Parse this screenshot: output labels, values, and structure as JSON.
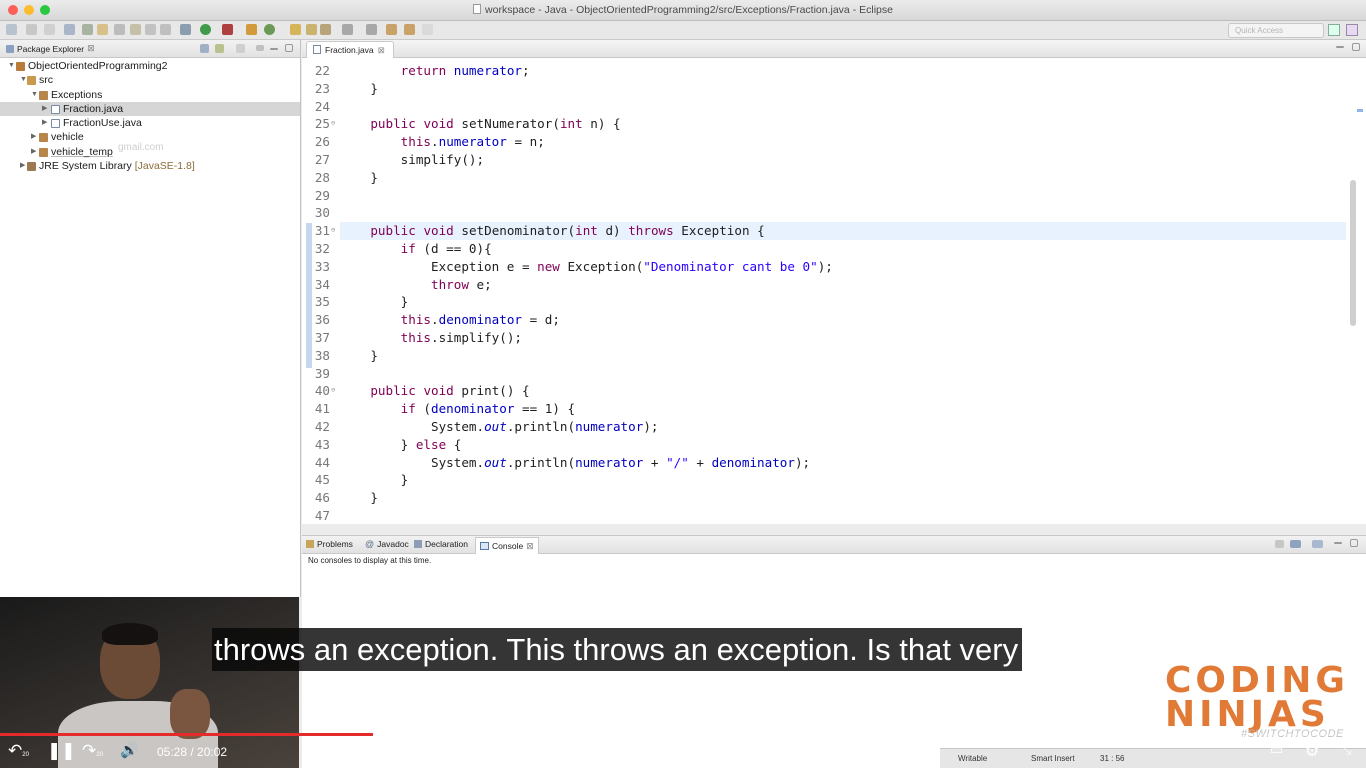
{
  "window": {
    "title": "workspace - Java - ObjectOrientedProgramming2/src/Exceptions/Fraction.java - Eclipse",
    "colors": {
      "close": "#fc5f57",
      "minimize": "#fdbc2e",
      "zoom": "#28c840"
    }
  },
  "toolbar": {
    "quick_access_placeholder": "Quick Access"
  },
  "package_explorer": {
    "tab_label": "Package Explorer",
    "tree": [
      {
        "label": "ObjectOrientedProgramming2",
        "icon": "java-project-icon"
      },
      {
        "label": "src",
        "icon": "source-folder-icon"
      },
      {
        "label": "Exceptions",
        "icon": "package-icon"
      },
      {
        "label": "Fraction.java",
        "icon": "java-file-icon",
        "selected": true
      },
      {
        "label": "FractionUse.java",
        "icon": "java-file-icon"
      },
      {
        "label": "vehicle",
        "icon": "package-icon"
      },
      {
        "label": "vehicle_temp",
        "icon": "package-icon"
      },
      {
        "label": "JRE System Library",
        "suffix": "[JavaSE-1.8]",
        "icon": "library-icon"
      }
    ],
    "watermark": "gmail.com"
  },
  "editor": {
    "tab_label": "Fraction.java",
    "current_line": 31,
    "lines": [
      {
        "n": "22",
        "text": "        return numerator;"
      },
      {
        "n": "23",
        "text": "    }"
      },
      {
        "n": "24",
        "text": ""
      },
      {
        "n": "25",
        "text": "    public void setNumerator(int n) {"
      },
      {
        "n": "26",
        "text": "        this.numerator = n;"
      },
      {
        "n": "27",
        "text": "        simplify();"
      },
      {
        "n": "28",
        "text": "    }"
      },
      {
        "n": "29",
        "text": ""
      },
      {
        "n": "30",
        "text": ""
      },
      {
        "n": "31",
        "text": "    public void setDenominator(int d) throws Exception {"
      },
      {
        "n": "32",
        "text": "        if (d == 0){"
      },
      {
        "n": "33",
        "text": "            Exception e = new Exception(\"Denominator cant be 0\");"
      },
      {
        "n": "34",
        "text": "            throw e;"
      },
      {
        "n": "35",
        "text": "        }"
      },
      {
        "n": "36",
        "text": "        this.denominator = d;"
      },
      {
        "n": "37",
        "text": "        this.simplify();"
      },
      {
        "n": "38",
        "text": "    }"
      },
      {
        "n": "39",
        "text": ""
      },
      {
        "n": "40",
        "text": "    public void print() {"
      },
      {
        "n": "41",
        "text": "        if (denominator == 1) {"
      },
      {
        "n": "42",
        "text": "            System.out.println(numerator);"
      },
      {
        "n": "43",
        "text": "        } else {"
      },
      {
        "n": "44",
        "text": "            System.out.println(numerator + \"/\" + denominator);"
      },
      {
        "n": "45",
        "text": "        }"
      },
      {
        "n": "46",
        "text": "    }"
      },
      {
        "n": "47",
        "text": ""
      }
    ]
  },
  "bottom_panel": {
    "tabs": [
      "Problems",
      "Javadoc",
      "Declaration",
      "Console"
    ],
    "active_tab": "Console",
    "message": "No consoles to display at this time."
  },
  "status_bar": {
    "mode": "Writable",
    "insert": "Smart Insert",
    "position": "31 : 56"
  },
  "video": {
    "subtitle": "throws an exception. This throws an exception. Is that very",
    "time_current": "05:28",
    "time_total": "20:02",
    "progress": 0.273,
    "buffered": 0.372,
    "skip_back_label": "20",
    "skip_forward_label": "20"
  },
  "brand": {
    "line1": "CODING",
    "line2": "NINJAS",
    "tagline": "#SWITCHTOCODE",
    "colors": {
      "primary": "#e07a36",
      "secondary": "#5a5a5a"
    }
  }
}
